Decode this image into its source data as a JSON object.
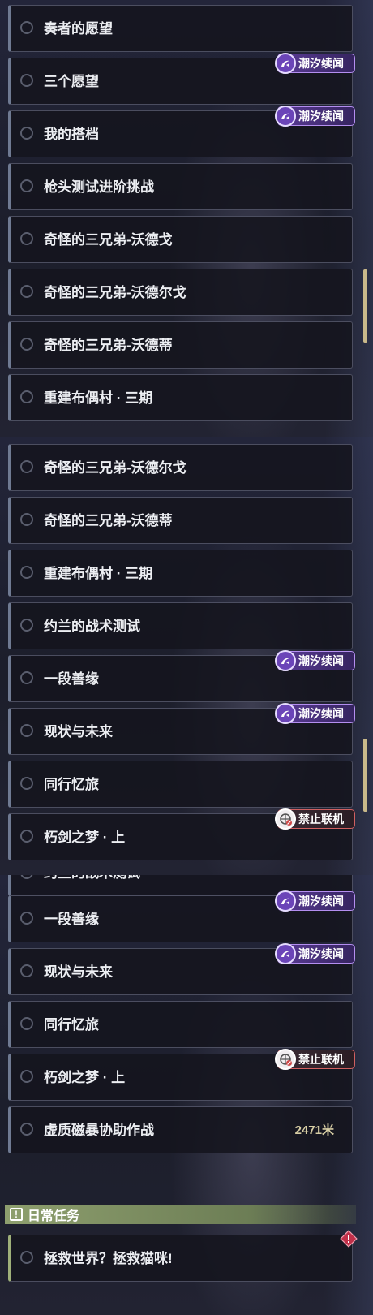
{
  "badges": {
    "tide_label": "潮汐续闻",
    "no_online_label": "禁止联机",
    "tide_icon": "tide-swirl-icon",
    "no_online_icon": "no-online-icon"
  },
  "panels": [
    {
      "items": [
        {
          "title": "奏者的愿望"
        },
        {
          "title": "三个愿望"
        },
        {
          "title": "我的搭档"
        },
        {
          "title": "枪头测试进阶挑战"
        },
        {
          "title": "奇怪的三兄弟-沃德戈"
        },
        {
          "title": "奇怪的三兄弟-沃德尔戈"
        },
        {
          "title": "奇怪的三兄弟-沃德蒂"
        },
        {
          "title": "重建布偶村 · 三期"
        }
      ]
    },
    {
      "items": [
        {
          "title": "奇怪的三兄弟-沃德尔戈"
        },
        {
          "title": "奇怪的三兄弟-沃德蒂"
        },
        {
          "title": "重建布偶村 · 三期"
        },
        {
          "title": "约兰的战术测试"
        },
        {
          "title": "一段善缘"
        },
        {
          "title": "现状与未来"
        },
        {
          "title": "同行忆旅"
        },
        {
          "title": "朽剑之梦 · 上"
        }
      ]
    },
    {
      "items": [
        {
          "title": "约兰的战术测试"
        },
        {
          "title": "一段善缘"
        },
        {
          "title": "现状与未来"
        },
        {
          "title": "同行忆旅"
        },
        {
          "title": "朽剑之梦 · 上"
        },
        {
          "title": "虚质磁暴协助作战",
          "distance": "2471米"
        }
      ]
    }
  ],
  "daily_section": {
    "title": "日常任务",
    "icon": "exclamation-box-icon",
    "items": [
      {
        "title": "拯救世界？拯救猫咪!"
      }
    ]
  },
  "colors": {
    "tide_badge": "#5b3c97",
    "no_online_border": "#d06060",
    "scrollbar": "#c9b98a",
    "section_header": "#8e9f6e",
    "alert": "#c0304a"
  }
}
